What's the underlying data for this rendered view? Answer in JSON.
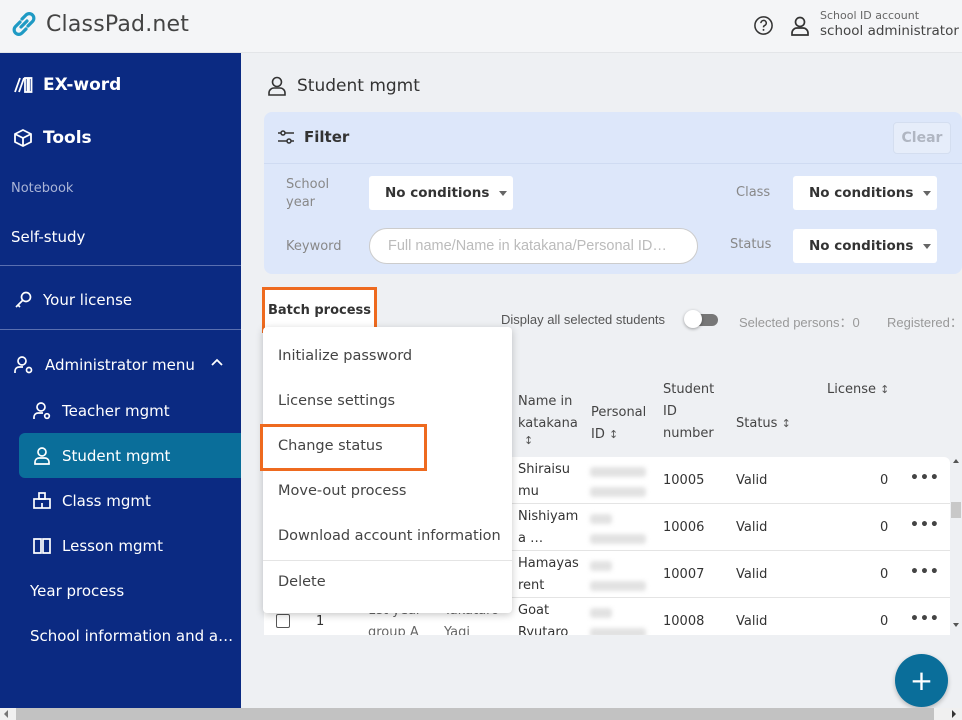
{
  "app": {
    "title": "ClassPad.net"
  },
  "header": {
    "account_type": "School ID account",
    "account_name": "school administrator"
  },
  "sidebar": {
    "exword": "EX-word",
    "tools": "Tools",
    "notebook": "Notebook",
    "self_study": "Self-study",
    "your_license": "Your license",
    "admin_menu": "Administrator menu",
    "items": [
      {
        "label": "Teacher mgmt"
      },
      {
        "label": "Student mgmt",
        "active": true
      },
      {
        "label": "Class mgmt"
      },
      {
        "label": "Lesson mgmt"
      }
    ],
    "year_process": "Year process",
    "school_info": "School information and a…"
  },
  "page": {
    "title": "Student mgmt"
  },
  "filter": {
    "title": "Filter",
    "clear_label": "Clear",
    "school_year_label": "School year",
    "school_year_value": "No conditions",
    "class_label": "Class",
    "class_value": "No conditions",
    "keyword_label": "Keyword",
    "keyword_placeholder": "Full name/Name in katakana/Personal ID…",
    "status_label": "Status",
    "status_value": "No conditions"
  },
  "toolbar": {
    "batch_process": "Batch process",
    "display_all": "Display all selected students",
    "selected_persons": "Selected persons：0",
    "registered": "Registered："
  },
  "batch_menu": {
    "items": [
      "Initialize password",
      "License settings",
      "Change status",
      "Move-out process",
      "Download account information",
      "Delete"
    ],
    "highlighted": "Change status"
  },
  "table": {
    "headers": {
      "katakana": [
        "Name in",
        "katakana"
      ],
      "personal_id": [
        "Personal",
        "ID"
      ],
      "student_id": [
        "Student",
        "ID",
        "number"
      ],
      "status": "Status",
      "license": "License"
    },
    "rows": [
      {
        "katakana": [
          "Shiraisu",
          "mu"
        ],
        "student_id": "10005",
        "status": "Valid",
        "license": "0"
      },
      {
        "katakana": [
          "Nishiyam",
          "a …"
        ],
        "student_id": "10006",
        "status": "Valid",
        "license": "0"
      },
      {
        "katakana": [
          "Hamayas",
          "rent"
        ],
        "student_id": "10007",
        "status": "Valid",
        "license": "0"
      },
      {
        "katakana": [
          "Goat",
          "Ryutaro"
        ],
        "no": "1",
        "class": [
          "1st year",
          "group A"
        ],
        "name": [
          "Takataro",
          "Yagi"
        ],
        "student_id": "10008",
        "status": "Valid",
        "license": "0"
      }
    ],
    "more_label": "•••"
  },
  "fab": {
    "label": "+"
  },
  "colors": {
    "sidebar": "#0b2a82",
    "active": "#0a6e9a",
    "highlight": "#ee6a1f",
    "filter_bg": "#dde7fa"
  }
}
